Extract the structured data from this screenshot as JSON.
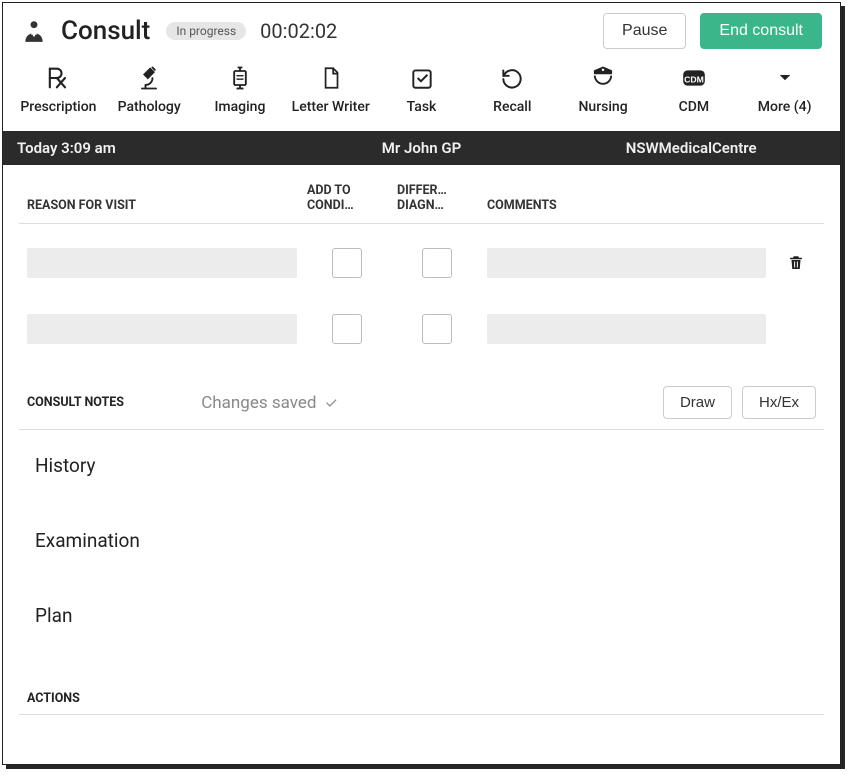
{
  "header": {
    "title": "Consult",
    "status": "In progress",
    "timer": "00:02:02",
    "pause_label": "Pause",
    "end_label": "End consult"
  },
  "toolbar": [
    {
      "key": "prescription",
      "label": "Prescription"
    },
    {
      "key": "pathology",
      "label": "Pathology"
    },
    {
      "key": "imaging",
      "label": "Imaging"
    },
    {
      "key": "letter",
      "label": "Letter Writer"
    },
    {
      "key": "task",
      "label": "Task"
    },
    {
      "key": "recall",
      "label": "Recall"
    },
    {
      "key": "nursing",
      "label": "Nursing"
    },
    {
      "key": "cdm",
      "label": "CDM"
    },
    {
      "key": "more",
      "label": "More (4)"
    }
  ],
  "infobar": {
    "time": "Today 3:09 am",
    "provider": "Mr John GP",
    "clinic": "NSWMedicalCentre"
  },
  "rfv": {
    "head": {
      "reason": "REASON FOR VISIT",
      "add": "ADD TO CONDI…",
      "diff": "DIFFER… DIAGN…",
      "comments": "COMMENTS"
    }
  },
  "notes": {
    "label": "CONSULT NOTES",
    "saved": "Changes saved",
    "draw_label": "Draw",
    "hx_label": "Hx/Ex",
    "history": "History",
    "exam": "Examination",
    "plan": "Plan"
  },
  "actions_label": "ACTIONS"
}
